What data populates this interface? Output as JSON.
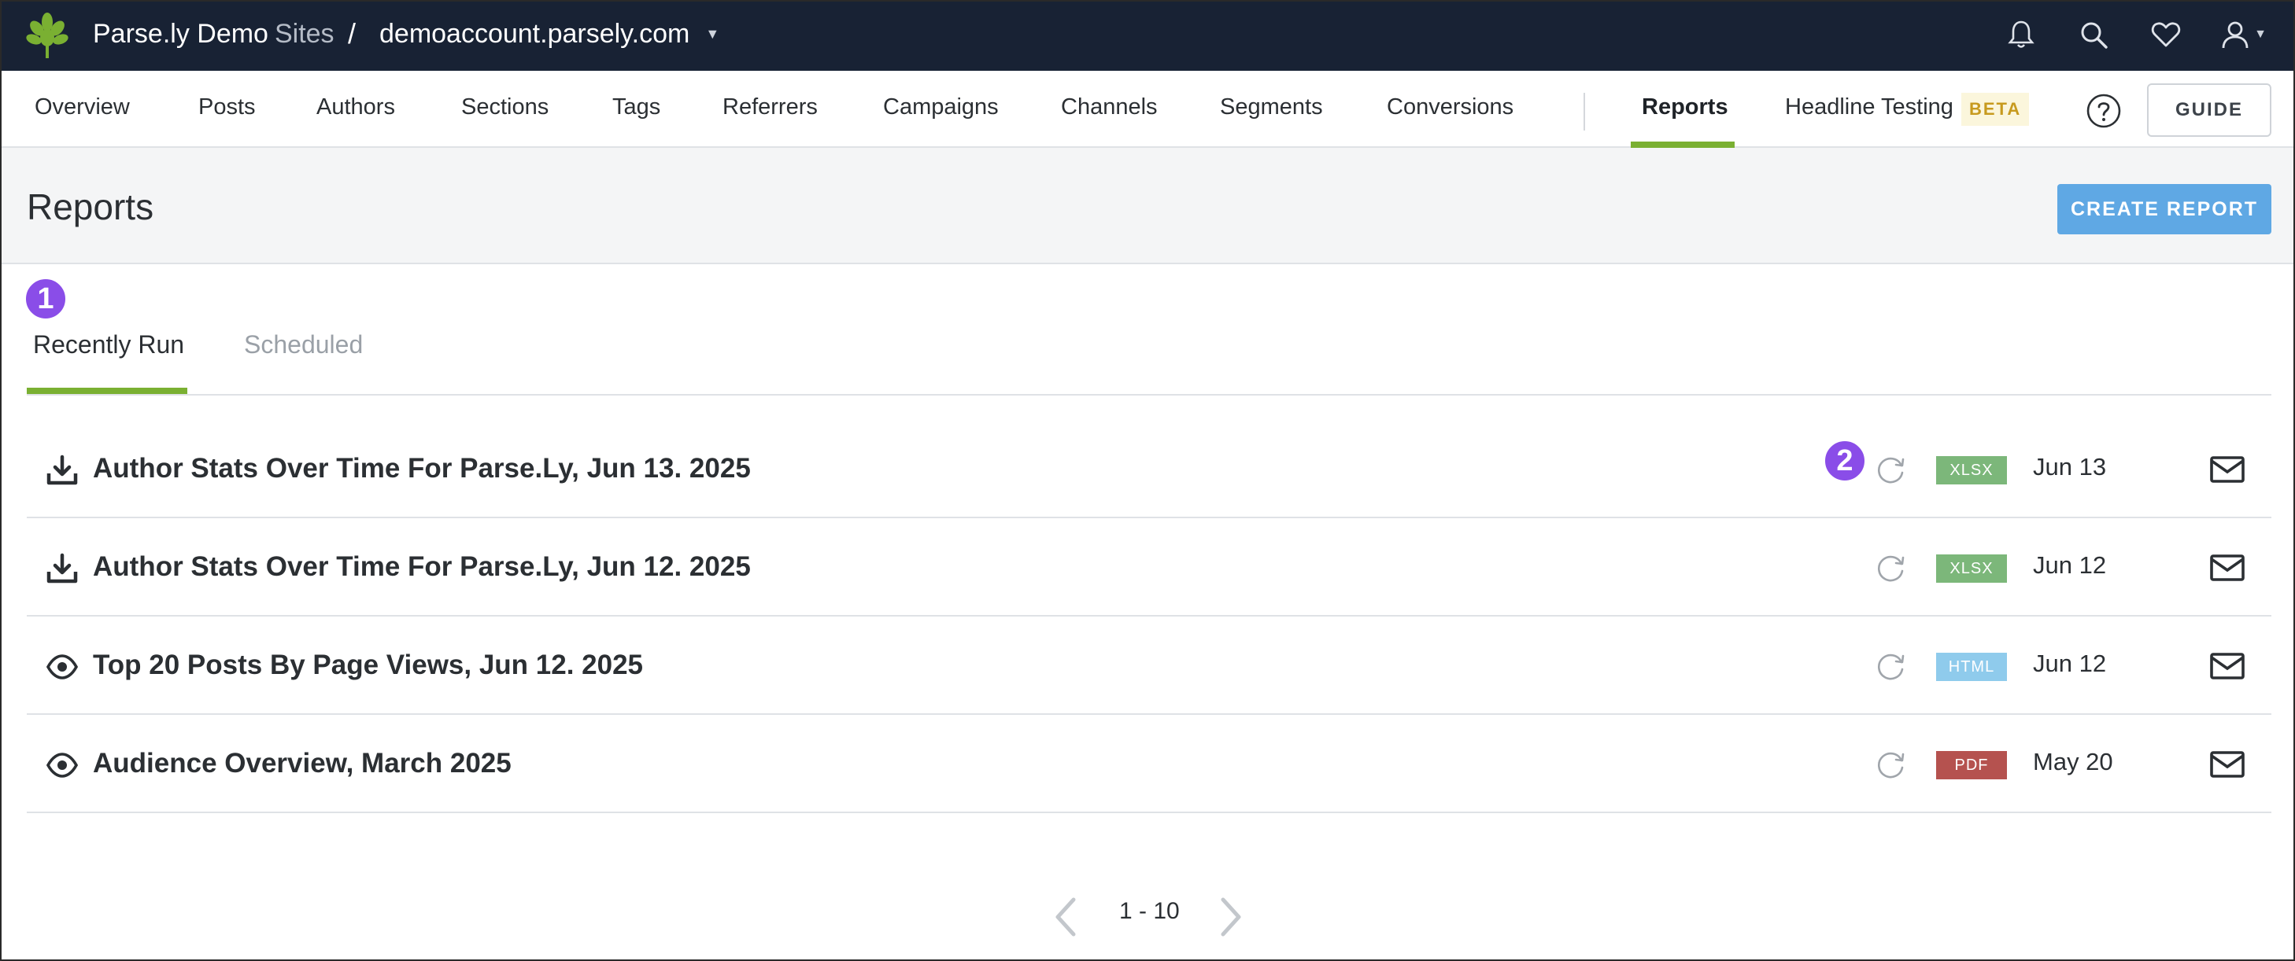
{
  "topbar": {
    "brand": "Parse.ly Demo",
    "sites_label": "Sites",
    "separator": "/",
    "site": "demoaccount.parsely.com",
    "caret": "▼",
    "icons": [
      "bell-icon",
      "search-icon",
      "heart-icon",
      "user-icon"
    ]
  },
  "nav": {
    "items": [
      "Overview",
      "Posts",
      "Authors",
      "Sections",
      "Tags",
      "Referrers",
      "Campaigns",
      "Channels",
      "Segments",
      "Conversions"
    ],
    "active": "Reports",
    "headline_testing": "Headline Testing",
    "beta": "BETA",
    "guide": "GUIDE",
    "accent": "#7ab032"
  },
  "page": {
    "title": "Reports",
    "create_button": "CREATE REPORT"
  },
  "tabs": {
    "recently_run": "Recently Run",
    "scheduled": "Scheduled",
    "marker": "1"
  },
  "reports": [
    {
      "icon": "download-icon",
      "title": "Author Stats Over Time For Parse.Ly, Jun 13. 2025",
      "format": "XLSX",
      "format_color": "#7cb77a",
      "date": "Jun 13",
      "marker": "2"
    },
    {
      "icon": "download-icon",
      "title": "Author Stats Over Time For Parse.Ly, Jun 12. 2025",
      "format": "XLSX",
      "format_color": "#7cb77a",
      "date": "Jun 12"
    },
    {
      "icon": "eye-icon",
      "title": "Top 20 Posts By Page Views, Jun 12. 2025",
      "format": "HTML",
      "format_color": "#8fcbec",
      "date": "Jun 12"
    },
    {
      "icon": "eye-icon",
      "title": "Audience Overview, March 2025",
      "format": "PDF",
      "format_color": "#b5524f",
      "date": "May 20"
    }
  ],
  "pagination": {
    "range": "1 - 10"
  }
}
